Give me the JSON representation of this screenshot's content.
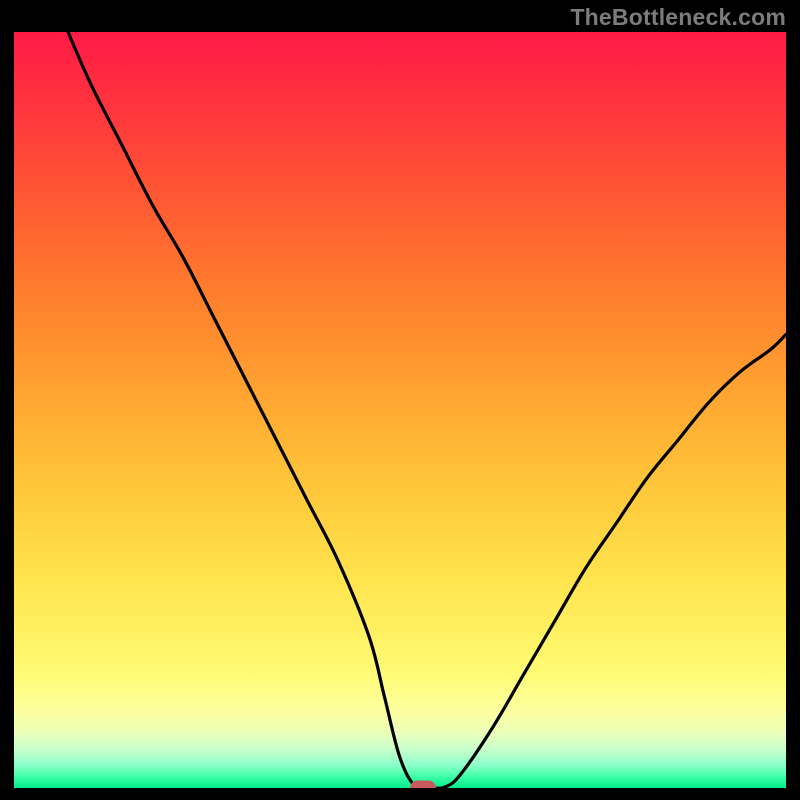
{
  "watermark": "TheBottleneck.com",
  "colors": {
    "curve": "#000000",
    "marker": "#c85a5d",
    "frame": "#000000"
  },
  "chart_data": {
    "type": "line",
    "title": "",
    "xlabel": "",
    "ylabel": "",
    "xlim": [
      0,
      100
    ],
    "ylim": [
      0,
      100
    ],
    "grid": false,
    "series": [
      {
        "name": "bottleneck-curve",
        "x": [
          7,
          10,
          14,
          18,
          22,
          26,
          30,
          34,
          38,
          42,
          46,
          48,
          50,
          52,
          54,
          56,
          58,
          62,
          66,
          70,
          74,
          78,
          82,
          86,
          90,
          94,
          98,
          100
        ],
        "values": [
          100,
          93,
          85,
          77,
          70,
          62,
          54,
          46,
          38,
          30,
          20,
          12,
          4,
          0.2,
          0,
          0.2,
          2,
          8,
          15,
          22,
          29,
          35,
          41,
          46,
          51,
          55,
          58,
          60
        ]
      }
    ],
    "marker": {
      "x": 53,
      "y": 0
    },
    "annotations": []
  }
}
